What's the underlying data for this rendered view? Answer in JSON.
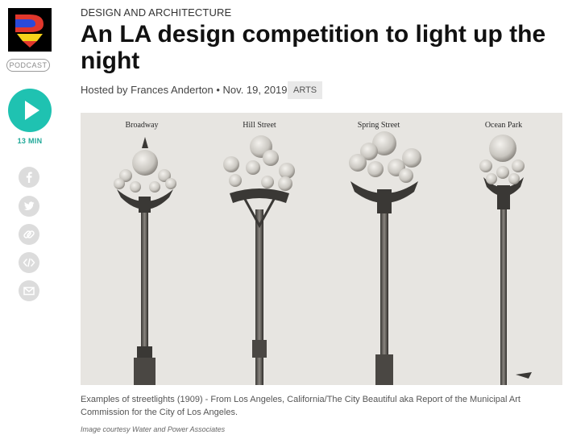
{
  "sidebar": {
    "logo_icon": "kcrw-logo",
    "podcast_label": "PODCAST",
    "play_icon": "play-icon",
    "duration": "13 MIN",
    "accent_color": "#1fc2b1",
    "share": [
      {
        "name": "facebook-icon"
      },
      {
        "name": "twitter-icon"
      },
      {
        "name": "link-icon"
      },
      {
        "name": "embed-icon"
      },
      {
        "name": "email-icon"
      }
    ]
  },
  "article": {
    "category": "DESIGN AND ARCHITECTURE",
    "title": "An LA design competition to light up the night",
    "byline": "Hosted by Frances Anderton • Nov. 19, 2019",
    "tag": "ARTS"
  },
  "photo": {
    "labels": [
      "Broadway",
      "Hill Street",
      "Spring Street",
      "Ocean Park"
    ],
    "caption": "Examples of streetlights (1909) - From Los Angeles, California/The City Beautiful aka Report of the Municipal Art Commission for the City of Los Angeles.",
    "credit": "Image courtesy Water and Power Associates"
  }
}
